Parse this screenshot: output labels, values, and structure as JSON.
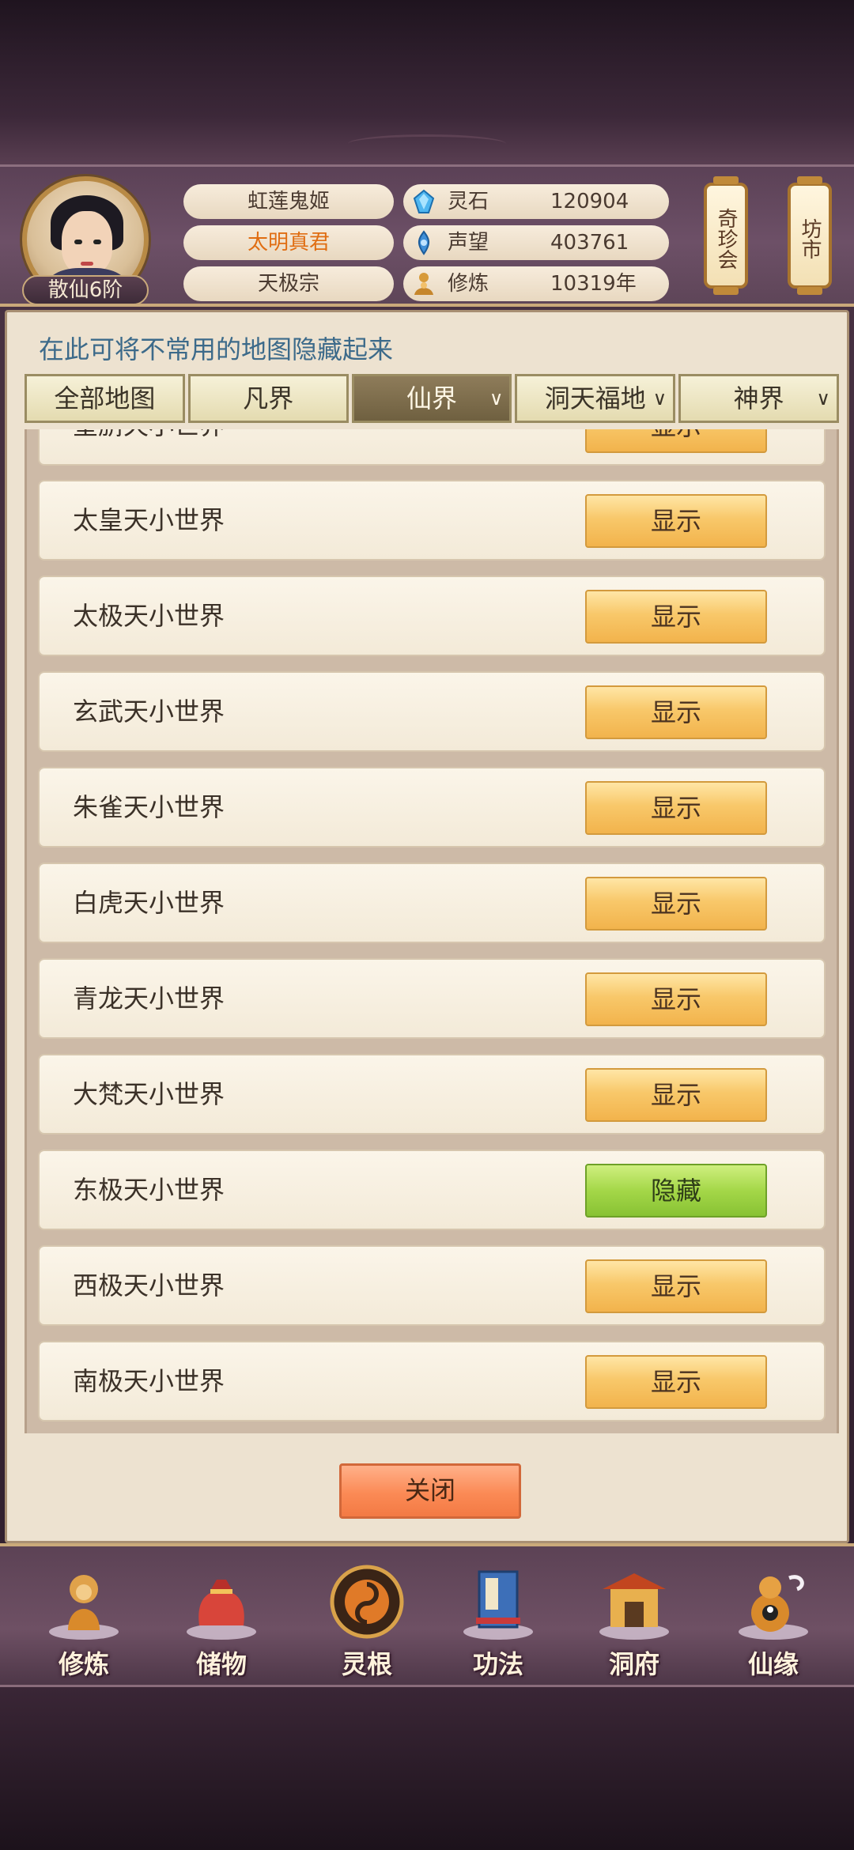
{
  "player": {
    "name": "虹莲鬼姬",
    "title": "太明真君",
    "sect": "天极宗",
    "rank": "散仙6阶"
  },
  "stats": [
    {
      "label": "灵石",
      "value": "120904",
      "icon": "spirit-stone-icon"
    },
    {
      "label": "声望",
      "value": "403761",
      "icon": "prestige-icon"
    },
    {
      "label": "修炼",
      "value": "10319年",
      "icon": "cultivation-icon"
    }
  ],
  "side_buttons": [
    {
      "label": "奇珍会"
    },
    {
      "label": "坊市"
    }
  ],
  "panel": {
    "title": "在此可将不常用的地图隐藏起来",
    "tabs": [
      {
        "label": "全部地图",
        "active": false,
        "dropdown": false
      },
      {
        "label": "凡界",
        "active": false,
        "dropdown": false
      },
      {
        "label": "仙界",
        "active": true,
        "dropdown": true
      },
      {
        "label": "洞天福地",
        "active": false,
        "dropdown": true
      },
      {
        "label": "神界",
        "active": false,
        "dropdown": true
      }
    ],
    "partial_row": {
      "label": "皇旃天小世界",
      "button": "显示"
    },
    "rows": [
      {
        "label": "太皇天小世界",
        "button": "显示",
        "state": "show"
      },
      {
        "label": "太极天小世界",
        "button": "显示",
        "state": "show"
      },
      {
        "label": "玄武天小世界",
        "button": "显示",
        "state": "show"
      },
      {
        "label": "朱雀天小世界",
        "button": "显示",
        "state": "show"
      },
      {
        "label": "白虎天小世界",
        "button": "显示",
        "state": "show"
      },
      {
        "label": "青龙天小世界",
        "button": "显示",
        "state": "show"
      },
      {
        "label": "大梵天小世界",
        "button": "显示",
        "state": "show"
      },
      {
        "label": "东极天小世界",
        "button": "隐藏",
        "state": "hide"
      },
      {
        "label": "西极天小世界",
        "button": "显示",
        "state": "show"
      },
      {
        "label": "南极天小世界",
        "button": "显示",
        "state": "show"
      }
    ],
    "close_label": "关闭"
  },
  "nav": [
    {
      "label": "修炼",
      "icon": "cultivation-monk-icon"
    },
    {
      "label": "储物",
      "icon": "storage-bag-icon"
    },
    {
      "label": "灵根",
      "icon": "spirit-root-icon"
    },
    {
      "label": "功法",
      "icon": "technique-book-icon"
    },
    {
      "label": "洞府",
      "icon": "cave-mansion-icon"
    },
    {
      "label": "仙缘",
      "icon": "immortal-gourd-icon"
    }
  ],
  "colors": {
    "show_button": "#f8c86a",
    "hide_button": "#a4d748",
    "close_button": "#fb8a55",
    "title_text": "#3c6a8a",
    "player_title": "#e06d12"
  }
}
